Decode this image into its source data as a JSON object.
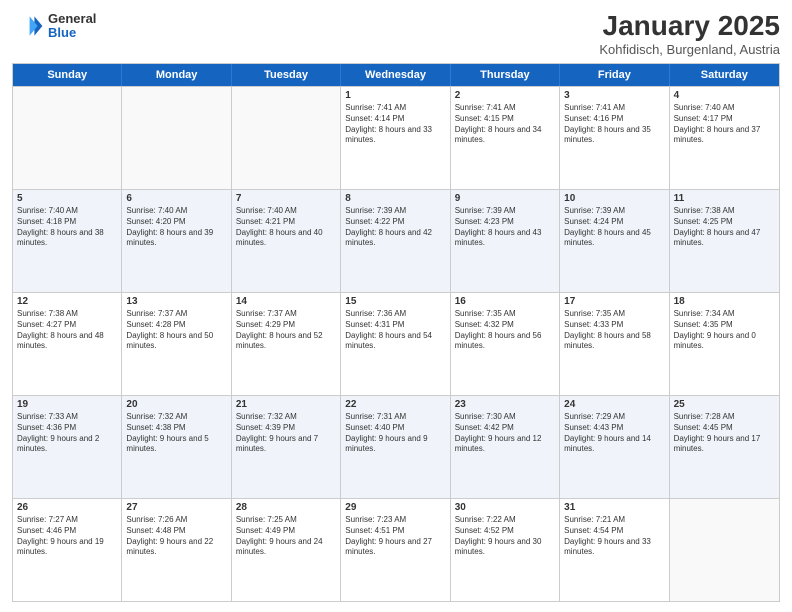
{
  "logo": {
    "general": "General",
    "blue": "Blue"
  },
  "title": "January 2025",
  "subtitle": "Kohfidisch, Burgenland, Austria",
  "days": [
    "Sunday",
    "Monday",
    "Tuesday",
    "Wednesday",
    "Thursday",
    "Friday",
    "Saturday"
  ],
  "rows": [
    [
      {
        "date": "",
        "info": ""
      },
      {
        "date": "",
        "info": ""
      },
      {
        "date": "",
        "info": ""
      },
      {
        "date": "1",
        "info": "Sunrise: 7:41 AM\nSunset: 4:14 PM\nDaylight: 8 hours and 33 minutes."
      },
      {
        "date": "2",
        "info": "Sunrise: 7:41 AM\nSunset: 4:15 PM\nDaylight: 8 hours and 34 minutes."
      },
      {
        "date": "3",
        "info": "Sunrise: 7:41 AM\nSunset: 4:16 PM\nDaylight: 8 hours and 35 minutes."
      },
      {
        "date": "4",
        "info": "Sunrise: 7:40 AM\nSunset: 4:17 PM\nDaylight: 8 hours and 37 minutes."
      }
    ],
    [
      {
        "date": "5",
        "info": "Sunrise: 7:40 AM\nSunset: 4:18 PM\nDaylight: 8 hours and 38 minutes."
      },
      {
        "date": "6",
        "info": "Sunrise: 7:40 AM\nSunset: 4:20 PM\nDaylight: 8 hours and 39 minutes."
      },
      {
        "date": "7",
        "info": "Sunrise: 7:40 AM\nSunset: 4:21 PM\nDaylight: 8 hours and 40 minutes."
      },
      {
        "date": "8",
        "info": "Sunrise: 7:39 AM\nSunset: 4:22 PM\nDaylight: 8 hours and 42 minutes."
      },
      {
        "date": "9",
        "info": "Sunrise: 7:39 AM\nSunset: 4:23 PM\nDaylight: 8 hours and 43 minutes."
      },
      {
        "date": "10",
        "info": "Sunrise: 7:39 AM\nSunset: 4:24 PM\nDaylight: 8 hours and 45 minutes."
      },
      {
        "date": "11",
        "info": "Sunrise: 7:38 AM\nSunset: 4:25 PM\nDaylight: 8 hours and 47 minutes."
      }
    ],
    [
      {
        "date": "12",
        "info": "Sunrise: 7:38 AM\nSunset: 4:27 PM\nDaylight: 8 hours and 48 minutes."
      },
      {
        "date": "13",
        "info": "Sunrise: 7:37 AM\nSunset: 4:28 PM\nDaylight: 8 hours and 50 minutes."
      },
      {
        "date": "14",
        "info": "Sunrise: 7:37 AM\nSunset: 4:29 PM\nDaylight: 8 hours and 52 minutes."
      },
      {
        "date": "15",
        "info": "Sunrise: 7:36 AM\nSunset: 4:31 PM\nDaylight: 8 hours and 54 minutes."
      },
      {
        "date": "16",
        "info": "Sunrise: 7:35 AM\nSunset: 4:32 PM\nDaylight: 8 hours and 56 minutes."
      },
      {
        "date": "17",
        "info": "Sunrise: 7:35 AM\nSunset: 4:33 PM\nDaylight: 8 hours and 58 minutes."
      },
      {
        "date": "18",
        "info": "Sunrise: 7:34 AM\nSunset: 4:35 PM\nDaylight: 9 hours and 0 minutes."
      }
    ],
    [
      {
        "date": "19",
        "info": "Sunrise: 7:33 AM\nSunset: 4:36 PM\nDaylight: 9 hours and 2 minutes."
      },
      {
        "date": "20",
        "info": "Sunrise: 7:32 AM\nSunset: 4:38 PM\nDaylight: 9 hours and 5 minutes."
      },
      {
        "date": "21",
        "info": "Sunrise: 7:32 AM\nSunset: 4:39 PM\nDaylight: 9 hours and 7 minutes."
      },
      {
        "date": "22",
        "info": "Sunrise: 7:31 AM\nSunset: 4:40 PM\nDaylight: 9 hours and 9 minutes."
      },
      {
        "date": "23",
        "info": "Sunrise: 7:30 AM\nSunset: 4:42 PM\nDaylight: 9 hours and 12 minutes."
      },
      {
        "date": "24",
        "info": "Sunrise: 7:29 AM\nSunset: 4:43 PM\nDaylight: 9 hours and 14 minutes."
      },
      {
        "date": "25",
        "info": "Sunrise: 7:28 AM\nSunset: 4:45 PM\nDaylight: 9 hours and 17 minutes."
      }
    ],
    [
      {
        "date": "26",
        "info": "Sunrise: 7:27 AM\nSunset: 4:46 PM\nDaylight: 9 hours and 19 minutes."
      },
      {
        "date": "27",
        "info": "Sunrise: 7:26 AM\nSunset: 4:48 PM\nDaylight: 9 hours and 22 minutes."
      },
      {
        "date": "28",
        "info": "Sunrise: 7:25 AM\nSunset: 4:49 PM\nDaylight: 9 hours and 24 minutes."
      },
      {
        "date": "29",
        "info": "Sunrise: 7:23 AM\nSunset: 4:51 PM\nDaylight: 9 hours and 27 minutes."
      },
      {
        "date": "30",
        "info": "Sunrise: 7:22 AM\nSunset: 4:52 PM\nDaylight: 9 hours and 30 minutes."
      },
      {
        "date": "31",
        "info": "Sunrise: 7:21 AM\nSunset: 4:54 PM\nDaylight: 9 hours and 33 minutes."
      },
      {
        "date": "",
        "info": ""
      }
    ]
  ]
}
